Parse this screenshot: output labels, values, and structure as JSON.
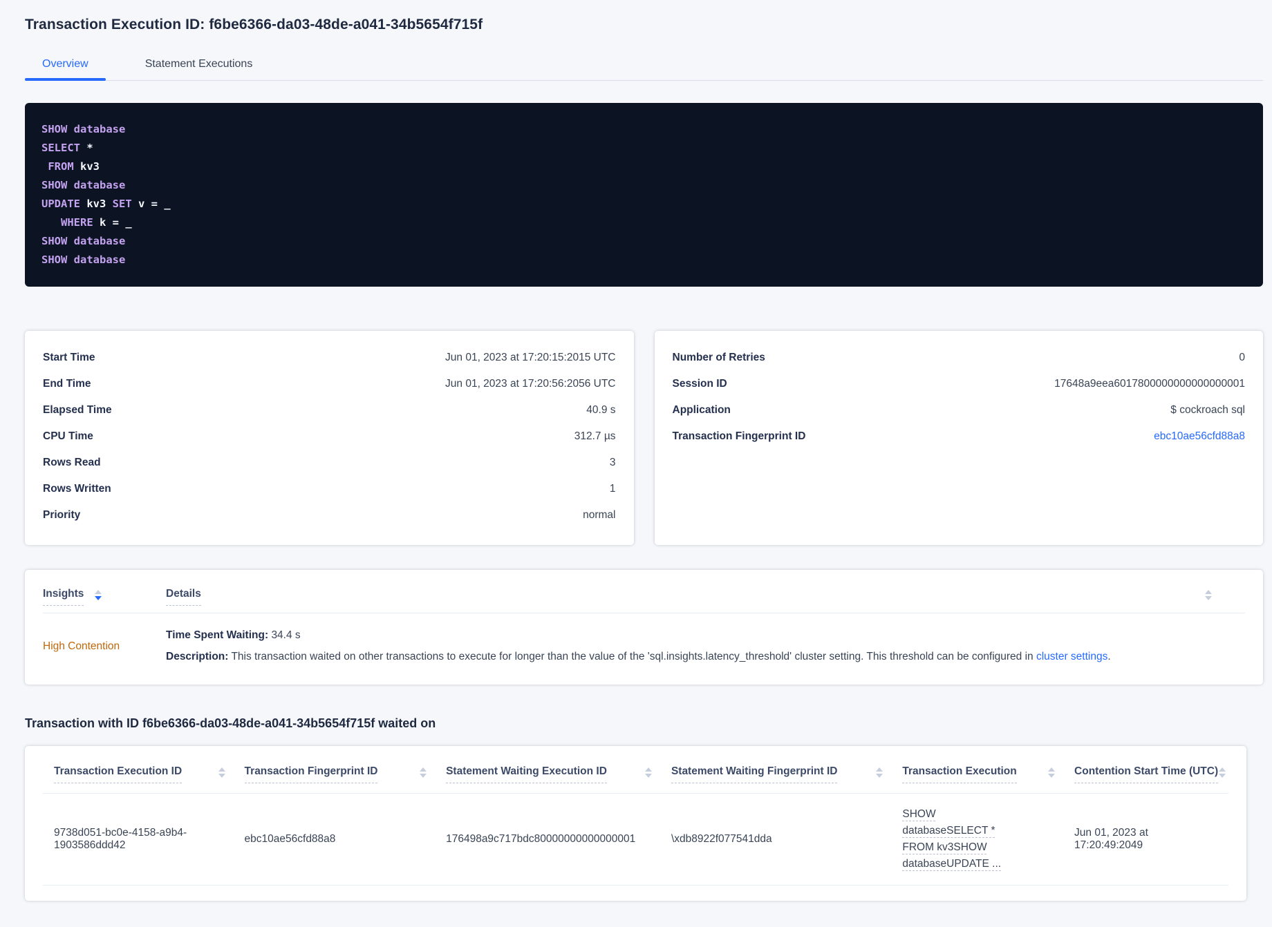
{
  "page": {
    "title": "Transaction Execution ID: f6be6366-da03-48de-a041-34b5654f715f",
    "waited_heading": "Transaction with ID f6be6366-da03-48de-a041-34b5654f715f waited on"
  },
  "colors": {
    "accent": "#2669ff",
    "warning_text": "#bf680c",
    "code_background": "#0c1322",
    "code_keyword": "#c3a2ef",
    "page_background": "#f5f7fa"
  },
  "tabs": [
    {
      "label": "Overview",
      "active": true
    },
    {
      "label": "Statement Executions",
      "active": false
    }
  ],
  "sql": {
    "lines": [
      [
        [
          "k",
          "SHOW database"
        ]
      ],
      [
        [
          "k",
          "SELECT"
        ],
        [
          "p",
          " *"
        ]
      ],
      [
        [
          "p",
          " "
        ],
        [
          "k",
          "FROM"
        ],
        [
          "p",
          " kv3"
        ]
      ],
      [
        [
          "k",
          "SHOW database"
        ]
      ],
      [
        [
          "k",
          "UPDATE"
        ],
        [
          "p",
          " kv3 "
        ],
        [
          "k",
          "SET"
        ],
        [
          "p",
          " v = _"
        ]
      ],
      [
        [
          "p",
          "   "
        ],
        [
          "k",
          "WHERE"
        ],
        [
          "p",
          " k = _"
        ]
      ],
      [
        [
          "k",
          "SHOW database"
        ]
      ],
      [
        [
          "k",
          "SHOW database"
        ]
      ]
    ]
  },
  "summary_left": {
    "rows": [
      {
        "label": "Start Time",
        "value": "Jun 01, 2023 at 17:20:15:2015 UTC"
      },
      {
        "label": "End Time",
        "value": "Jun 01, 2023 at 17:20:56:2056 UTC"
      },
      {
        "label": "Elapsed Time",
        "value": "40.9 s"
      },
      {
        "label": "CPU Time",
        "value": "312.7 µs"
      },
      {
        "label": "Rows Read",
        "value": "3"
      },
      {
        "label": "Rows Written",
        "value": "1"
      },
      {
        "label": "Priority",
        "value": "normal"
      }
    ]
  },
  "summary_right": {
    "rows": [
      {
        "label": "Number of Retries",
        "value": "0"
      },
      {
        "label": "Session ID",
        "value": "17648a9eea6017800000000000000001"
      },
      {
        "label": "Application",
        "value": "$ cockroach sql"
      },
      {
        "label": "Transaction Fingerprint ID",
        "value": "ebc10ae56cfd88a8",
        "link": true
      }
    ]
  },
  "insights": {
    "columns": [
      "Insights",
      "Details"
    ],
    "row": {
      "insight": "High Contention",
      "waiting_label": "Time Spent Waiting:",
      "waiting_value": "34.4 s",
      "description_label": "Description:",
      "description_text": "This transaction waited on other transactions to execute for longer than the value of the 'sql.insights.latency_threshold' cluster setting. This threshold can be configured in ",
      "description_link": "cluster settings",
      "description_suffix": "."
    }
  },
  "waited_table": {
    "columns": [
      "Transaction Execution ID",
      "Transaction Fingerprint ID",
      "Statement Waiting Execution ID",
      "Statement Waiting Fingerprint ID",
      "Transaction Execution",
      "Contention Start Time (UTC)"
    ],
    "rows": [
      {
        "transaction_execution_id": "9738d051-bc0e-4158-a9b4-1903586ddd42",
        "transaction_fingerprint_id": "ebc10ae56cfd88a8",
        "statement_waiting_execution_id": "176498a9c717bdc80000000000000001",
        "statement_waiting_fingerprint_id": "\\xdb8922f077541dda",
        "transaction_execution": "SHOW databaseSELECT * FROM kv3SHOW databaseUPDATE ...",
        "contention_start_time": "Jun 01, 2023 at 17:20:49:2049"
      }
    ]
  }
}
